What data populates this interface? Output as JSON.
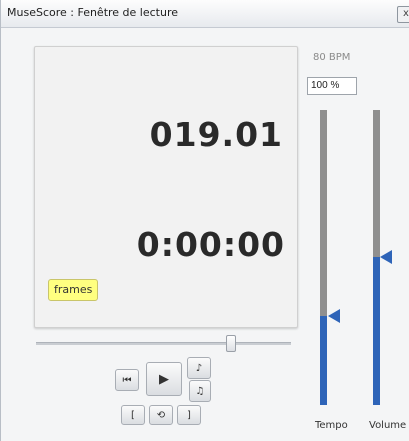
{
  "window": {
    "title": "MuseScore : Fenêtre de lecture",
    "close_label": "x"
  },
  "display": {
    "measure": "019.01",
    "time": "0:00:00",
    "mode_label": "frames"
  },
  "position": {
    "fraction": 0.76
  },
  "transport": {
    "rewind_label": "⏮",
    "play_label": "▶",
    "metronome_label": "♪",
    "loop_in_label": "[",
    "loop_label": "⟲",
    "loop_out_label": "]"
  },
  "tempo": {
    "bpm_label": "80 BPM",
    "value": "100 %",
    "label": "Tempo",
    "level": 0.3
  },
  "volume": {
    "label": "Volume",
    "level": 0.5
  },
  "colors": {
    "accent": "#2e64b8",
    "badge": "#ffff80"
  }
}
